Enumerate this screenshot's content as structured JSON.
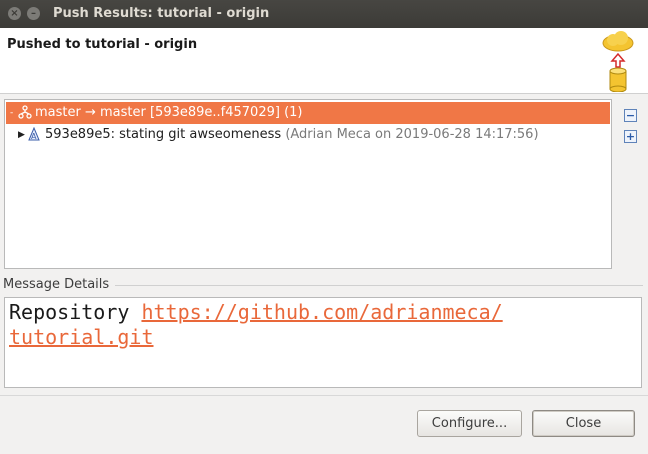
{
  "window": {
    "title": "Push Results: tutorial - origin",
    "close_glyph": "×",
    "min_glyph": "–"
  },
  "header": {
    "heading": "Pushed to tutorial - origin",
    "icon": "push-to-cloud-icon"
  },
  "tree": {
    "ref_row": {
      "label": "master → master [593e89e..f457029] (1)",
      "expanded": true,
      "icon": "branch-icon"
    },
    "commit_row": {
      "summary": "593e89e5: stating git awseomeness",
      "author": "(Adrian Meca on 2019-06-28 14:17:56)",
      "icon": "commit-icon"
    }
  },
  "side_toolbar": {
    "collapse_glyph": "−",
    "expand_glyph": "+"
  },
  "message": {
    "label": "Message Details",
    "prefix": "Repository ",
    "link_line1": "https://github.com/adrianmeca/",
    "link_line2": "tutorial.git"
  },
  "buttons": {
    "configure": "Configure...",
    "close": "Close"
  },
  "colors": {
    "selection": "#f07746",
    "link": "#e9683a",
    "titlebar": "#3c3b37"
  }
}
